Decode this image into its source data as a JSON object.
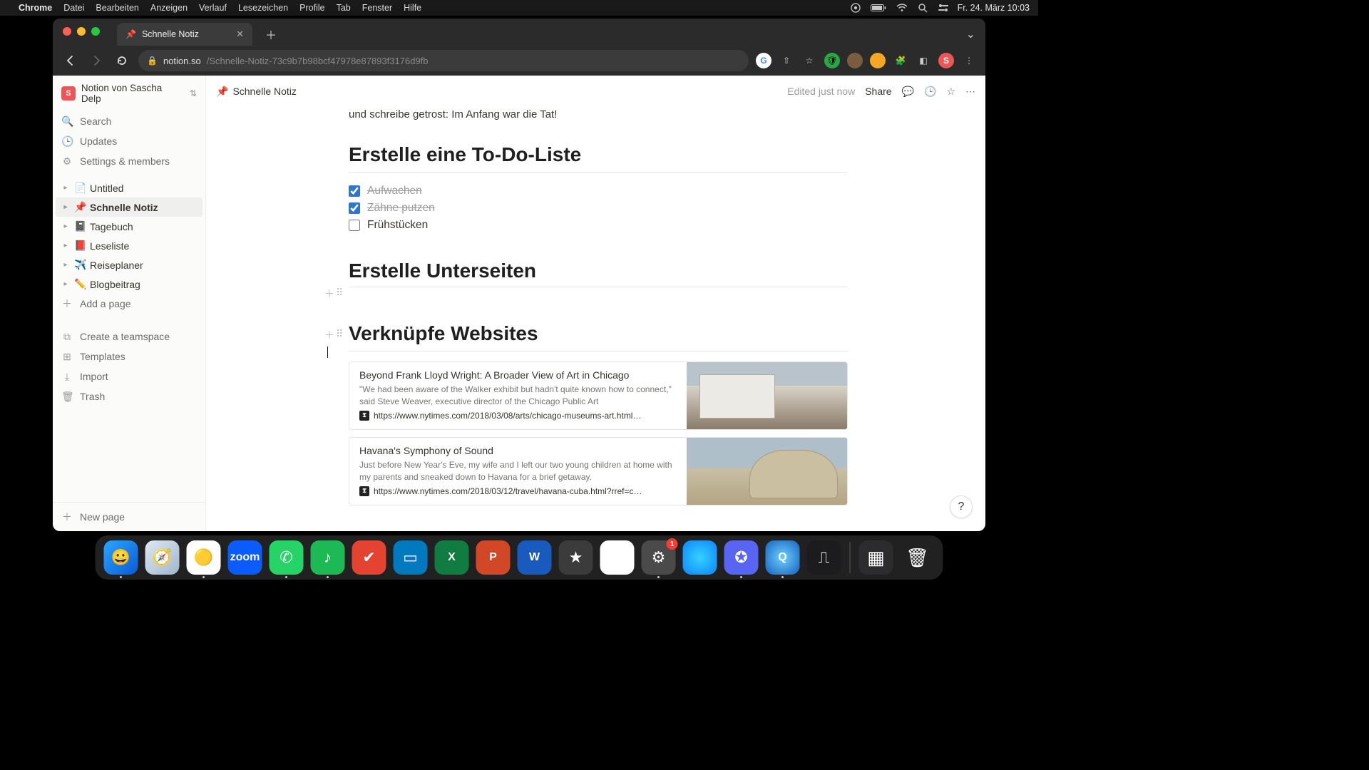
{
  "mac_menubar": {
    "app": "Chrome",
    "items": [
      "Datei",
      "Bearbeiten",
      "Anzeigen",
      "Verlauf",
      "Lesezeichen",
      "Profile",
      "Tab",
      "Fenster",
      "Hilfe"
    ],
    "datetime": "Fr. 24. März  10:03"
  },
  "browser": {
    "tab_title": "Schnelle Notiz",
    "tab_emoji": "📌",
    "url_host": "notion.so",
    "url_path": "/Schnelle-Notiz-73c9b7b98bcf47978e87893f3176d9fb"
  },
  "notion": {
    "workspace_initial": "S",
    "workspace_name": "Notion von Sascha Delp",
    "sidebar_top": [
      {
        "icon": "search",
        "label": "Search"
      },
      {
        "icon": "clock",
        "label": "Updates"
      },
      {
        "icon": "gear",
        "label": "Settings & members"
      }
    ],
    "pages": [
      {
        "emoji": "📄",
        "title": "Untitled",
        "active": false
      },
      {
        "emoji": "📌",
        "title": "Schnelle Notiz",
        "active": true
      },
      {
        "emoji": "📓",
        "title": "Tagebuch",
        "active": false
      },
      {
        "emoji": "📕",
        "title": "Leseliste",
        "active": false
      },
      {
        "emoji": "✈️",
        "title": "Reiseplaner",
        "active": false
      },
      {
        "emoji": "✏️",
        "title": "Blogbeitrag",
        "active": false
      }
    ],
    "add_page": "Add a page",
    "sidebar_bottom": [
      {
        "icon": "teamspace",
        "label": "Create a teamspace"
      },
      {
        "icon": "templates",
        "label": "Templates"
      },
      {
        "icon": "import",
        "label": "Import"
      },
      {
        "icon": "trash",
        "label": "Trash"
      }
    ],
    "new_page": "New page",
    "breadcrumb_emoji": "📌",
    "breadcrumb_title": "Schnelle Notiz",
    "edited_status": "Edited just now",
    "share_label": "Share",
    "content": {
      "intro_line": "und schreibe getrost: Im Anfang war die Tat!",
      "h_todo": "Erstelle eine To-Do-Liste",
      "todos": [
        {
          "label": "Aufwachen",
          "done": true
        },
        {
          "label": "Zähne putzen",
          "done": true
        },
        {
          "label": "Frühstücken",
          "done": false
        }
      ],
      "h_subpages": "Erstelle Unterseiten",
      "h_links": "Verknüpfe Websites",
      "bookmarks": [
        {
          "title": "Beyond Frank Lloyd Wright: A Broader View of Art in Chicago",
          "desc": "\"We had been aware of the Walker exhibit but hadn't quite known how to connect,\" said Steve Weaver, executive director of the Chicago Public Art",
          "url": "https://www.nytimes.com/2018/03/08/arts/chicago-museums-art.html…",
          "favicon": "𝕿",
          "img": "chicago"
        },
        {
          "title": "Havana's Symphony of Sound",
          "desc": "Just before New Year's Eve, my wife and I left our two young children at home with my parents and sneaked down to Havana for a brief getaway.",
          "url": "https://www.nytimes.com/2018/03/12/travel/havana-cuba.html?rref=c…",
          "favicon": "𝕿",
          "img": "havana"
        }
      ]
    }
  },
  "dock": {
    "apps": [
      {
        "name": "finder",
        "bg": "linear-gradient(135deg,#29a7ff,#0a5bd6)",
        "glyph": "😀",
        "running": true
      },
      {
        "name": "safari",
        "bg": "linear-gradient(135deg,#dfe8f0,#9fb7cc)",
        "glyph": "🧭",
        "running": false
      },
      {
        "name": "chrome",
        "bg": "#fff",
        "glyph": "🟡",
        "running": true
      },
      {
        "name": "zoom",
        "bg": "#0b5cff",
        "glyph": "zoom",
        "running": false,
        "text": true
      },
      {
        "name": "whatsapp",
        "bg": "#25d366",
        "glyph": "✆",
        "running": true
      },
      {
        "name": "spotify",
        "bg": "#1db954",
        "glyph": "♪",
        "running": true
      },
      {
        "name": "todoist",
        "bg": "#e44332",
        "glyph": "✔",
        "running": false
      },
      {
        "name": "trello",
        "bg": "#0079bf",
        "glyph": "▭",
        "running": false
      },
      {
        "name": "excel",
        "bg": "#107c41",
        "glyph": "X",
        "running": false,
        "text": true
      },
      {
        "name": "powerpoint",
        "bg": "#d24726",
        "glyph": "P",
        "running": false,
        "text": true
      },
      {
        "name": "word",
        "bg": "#185abd",
        "glyph": "W",
        "running": false,
        "text": true
      },
      {
        "name": "imovie",
        "bg": "#3b3b3b",
        "glyph": "★",
        "running": false
      },
      {
        "name": "drive",
        "bg": "#fff",
        "glyph": "▲",
        "running": false
      },
      {
        "name": "settings",
        "bg": "#4a4a4a",
        "glyph": "⚙",
        "running": true,
        "badge": "1"
      },
      {
        "name": "siri",
        "bg": "radial-gradient(circle,#37d1ff,#0a84ff)",
        "glyph": "",
        "running": false
      },
      {
        "name": "discord",
        "bg": "#5865f2",
        "glyph": "✪",
        "running": true
      },
      {
        "name": "quicktime",
        "bg": "radial-gradient(circle,#6fd0ff,#1560bd)",
        "glyph": "Q",
        "running": true,
        "text": true
      },
      {
        "name": "voice-memos",
        "bg": "#1c1c1e",
        "glyph": "⎍",
        "running": false
      }
    ],
    "right": [
      {
        "name": "mission-control",
        "bg": "#2c2c2e",
        "glyph": "▦"
      },
      {
        "name": "trash",
        "bg": "transparent",
        "glyph": "🗑"
      }
    ]
  }
}
